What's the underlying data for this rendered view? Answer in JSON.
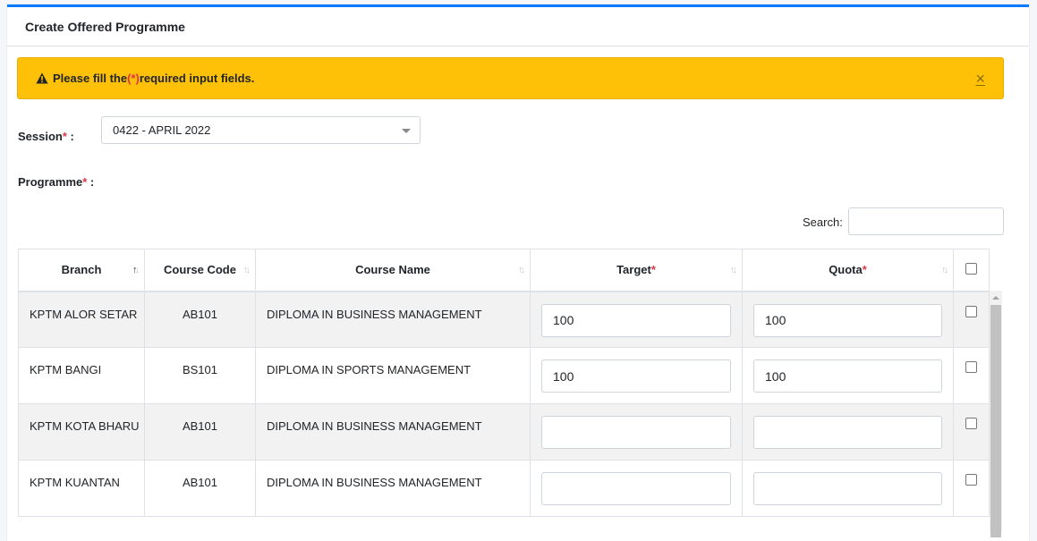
{
  "card": {
    "title": "Create Offered Programme"
  },
  "alert": {
    "text_before": "Please fill the ",
    "required_mark": "(*)",
    "text_after": "required input fields.",
    "close_label": "×"
  },
  "form": {
    "session_label": "Session",
    "programme_label": "Programme",
    "required_star": "*",
    "colon": " :",
    "session_value": "0422 - APRIL 2022"
  },
  "search": {
    "label": "Search:",
    "value": ""
  },
  "table": {
    "columns": [
      {
        "label": "Branch",
        "required": false
      },
      {
        "label": "Course Code",
        "required": false
      },
      {
        "label": "Course Name",
        "required": false
      },
      {
        "label": "Target",
        "required": true
      },
      {
        "label": "Quota",
        "required": true
      }
    ],
    "rows": [
      {
        "branch": "KPTM ALOR SETAR",
        "code": "AB101",
        "name": "DIPLOMA IN BUSINESS MANAGEMENT",
        "target": "100",
        "quota": "100"
      },
      {
        "branch": "KPTM BANGI",
        "code": "BS101",
        "name": "DIPLOMA IN SPORTS MANAGEMENT",
        "target": "100",
        "quota": "100"
      },
      {
        "branch": "KPTM KOTA BHARU",
        "code": "AB101",
        "name": "DIPLOMA IN BUSINESS MANAGEMENT",
        "target": "",
        "quota": ""
      },
      {
        "branch": "KPTM KUANTAN",
        "code": "AB101",
        "name": "DIPLOMA IN BUSINESS MANAGEMENT",
        "target": "",
        "quota": ""
      }
    ]
  },
  "colors": {
    "accent": "#007bff",
    "alert_bg": "#ffc107",
    "required": "#dc3545"
  }
}
